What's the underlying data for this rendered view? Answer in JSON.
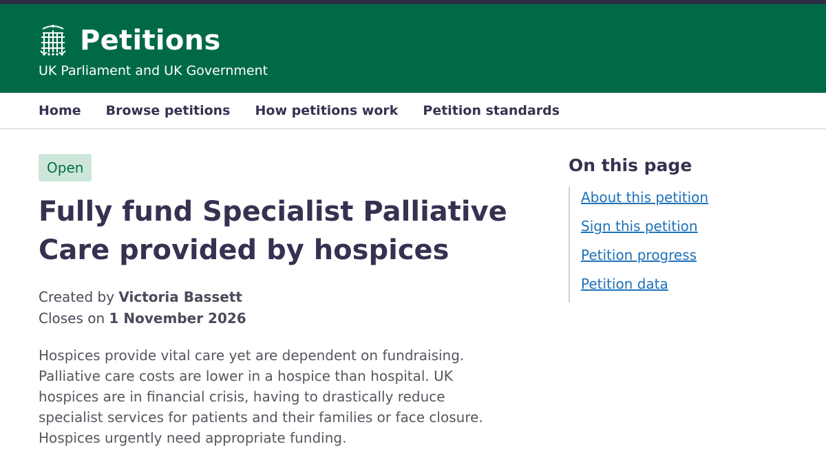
{
  "header": {
    "title": "Petitions",
    "subtitle": "UK Parliament and UK Government"
  },
  "nav": {
    "items": [
      "Home",
      "Browse petitions",
      "How petitions work",
      "Petition standards"
    ]
  },
  "petition": {
    "status": "Open",
    "title": "Fully fund Specialist Palliative Care provided by hospices",
    "created_label": "Created by",
    "creator": "Victoria Bassett",
    "closes_label": "Closes on",
    "close_date": "1 November 2026",
    "description": "Hospices provide vital care yet are dependent on fundraising. Palliative care costs are lower in a hospice than hospital. UK hospices are in financial crisis, having to drastically reduce specialist services for patients and their families or face closure. Hospices urgently need appropriate funding."
  },
  "aside": {
    "title": "On this page",
    "links": [
      "About this petition",
      "Sign this petition",
      "Petition progress",
      "Petition data"
    ]
  },
  "colors": {
    "header_bg": "#006a48",
    "topbar": "#2b2d45",
    "badge_bg": "#cde6da",
    "badge_text": "#00703c",
    "link": "#1d70b8",
    "heading": "#373151"
  },
  "icons": {
    "logo": "portcullis-icon"
  }
}
